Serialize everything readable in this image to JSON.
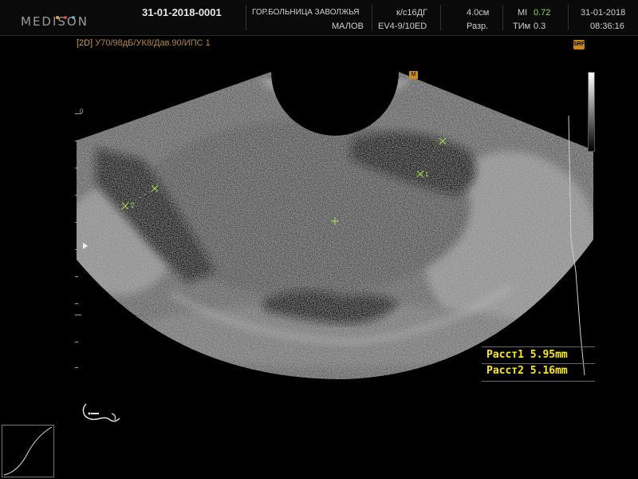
{
  "header": {
    "brand": "MEDISON",
    "dot_colors": [
      "#e8a33d",
      "#d84a3a",
      "#5aa0d8"
    ],
    "patient_id": "31-01-2018-0001",
    "hospital": "ГОР.БОЛЬНИЦА ЗАВОЛЖЬЯ",
    "operator": "МАЛОВ",
    "preset": "к/с16ДГ",
    "probe": "EV4-9/10ED",
    "depth": "4.0см",
    "resolution": "Разр.",
    "mi_label": "MI",
    "mi_value": "0.72",
    "tim_label": "ТИм",
    "tim_value": "0.3",
    "date": "31-01-2018",
    "time": "08:36:16"
  },
  "mode_line": {
    "mode": "[2D]",
    "params": "У70/98дБ/УК8/Дав.90/ИПС 1"
  },
  "markers": {
    "caliper1": "1",
    "caliper2": "2",
    "depth_zero": "0",
    "srf": "SRF",
    "probe_mark": "M"
  },
  "measurements": [
    {
      "label": "Расст1",
      "value": "5.95mm"
    },
    {
      "label": "Расст2",
      "value": "5.16mm"
    }
  ],
  "colors": {
    "measurement_text": "#ffeb00",
    "caliper": "#a6e84a",
    "accent_orange": "#c98a1a"
  }
}
